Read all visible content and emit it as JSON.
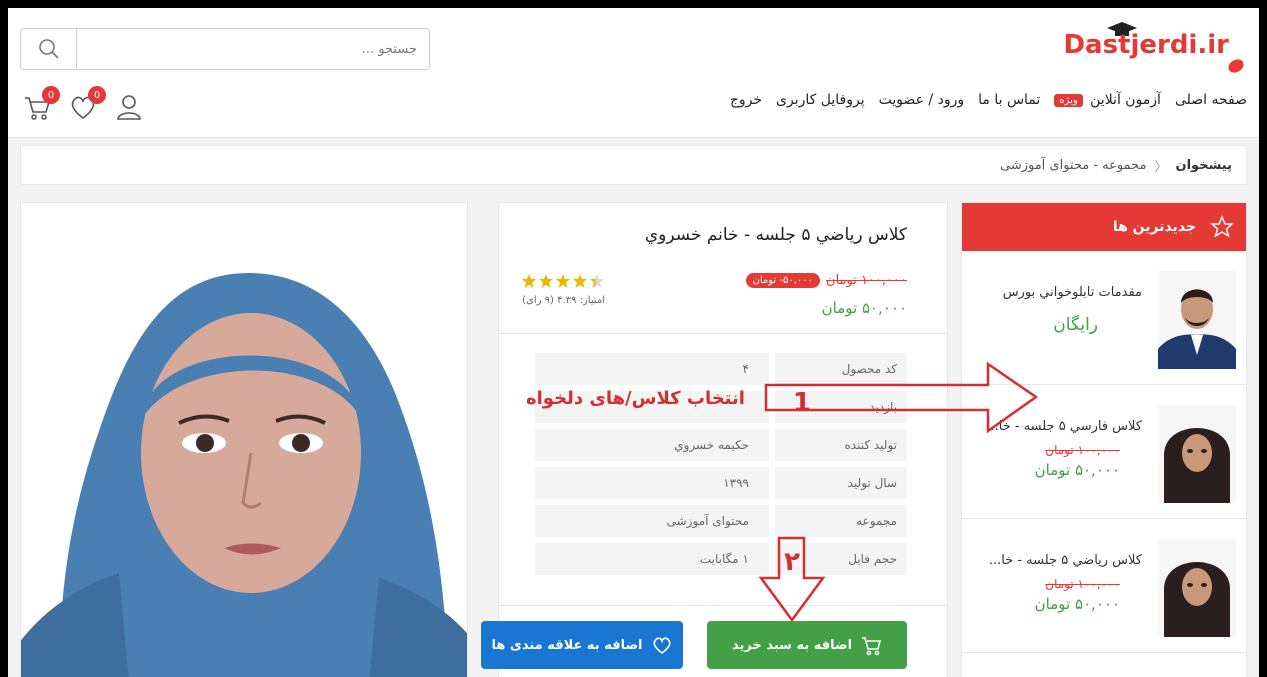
{
  "header": {
    "logo_text": "Dastjerdi.ir",
    "search_placeholder": "جستجو ...",
    "nav": {
      "home": "صفحه اصلی",
      "online_exam": "آزمون آنلاین",
      "special_badge": "ویژه",
      "contact": "تماس با ما",
      "login": "ورود / عضویت",
      "profile": "پروفایل کاربری",
      "logout": "خروج"
    },
    "wishlist_count": "0",
    "cart_count": "0"
  },
  "breadcrumb": {
    "home": "پیشخوان",
    "path": "مجموعه - محتوای آموزشی"
  },
  "sidebar": {
    "title": "جدیدترین ها",
    "items": [
      {
        "title": "مقدمات تابلوخواني بورس",
        "free_label": "رایگان"
      },
      {
        "title": "کلاس فارسي ۵ جلسه - خا...",
        "old_price": "۱۰۰,۰۰۰ تومان",
        "new_price": "۵۰,۰۰۰ تومان"
      },
      {
        "title": "کلاس رياضي ۵ جلسه - خا...",
        "old_price": "۱۰۰,۰۰۰ تومان",
        "new_price": "۵۰,۰۰۰ تومان"
      }
    ]
  },
  "product": {
    "title": "کلاس رياضي ۵ جلسه - خانم خسروي",
    "old_price": "۱۰۰,۰۰۰ تومان",
    "discount": "۵۰,۰۰۰- تومان",
    "new_price": "۵۰,۰۰۰ تومان",
    "rating_text": "امتیاز: ۴.۳۹ (۹ رای)",
    "rating_value": 4.39,
    "specs": [
      {
        "key": "کد محصول",
        "value": "۴"
      },
      {
        "key": "بازدید",
        "value": ""
      },
      {
        "key": "تولید کننده",
        "value": "حکیمه خسروي"
      },
      {
        "key": "سال تولید",
        "value": "۱۳۹۹"
      },
      {
        "key": "مجموعه",
        "value": "محتوای آموزشی"
      },
      {
        "key": "حجم فایل",
        "value": "۱ مگابایت"
      }
    ],
    "add_to_cart": "اضافه به سبد خرید",
    "add_to_wishlist": "اضافه به علاقه مندی ها"
  },
  "annotations": {
    "step1_number": "1",
    "step1_label": "انتخاب کلاس/های دلخواه",
    "step2_number": "۲"
  },
  "colors": {
    "brand_red": "#e53935",
    "green": "#43a047",
    "blue": "#1976d2"
  }
}
